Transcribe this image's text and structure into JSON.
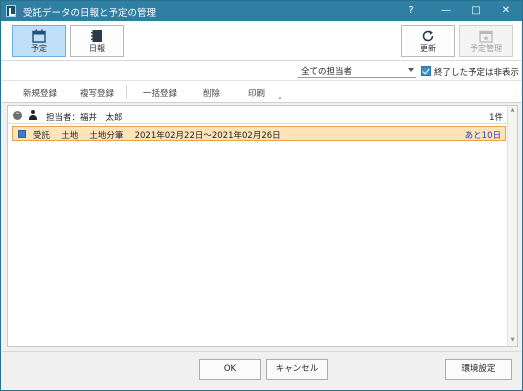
{
  "window": {
    "title": "受託データの日報と予定の管理",
    "help_label": "?",
    "minimize_label": "—",
    "maximize_label": "□",
    "close_label": "✕"
  },
  "ribbon": {
    "schedule_label": "予定",
    "daily_report_label": "日報",
    "refresh_label": "更新",
    "schedule_manage_label": "予定管理"
  },
  "filter": {
    "assignee_value": "全ての担当者",
    "hide_finished_label": "終了した予定は非表示",
    "hide_finished_checked": true
  },
  "actions": {
    "new_label": "新規登録",
    "copy_label": "複写登録",
    "bulk_label": "一括登録",
    "delete_label": "削除",
    "print_label": "印刷",
    "more_label": "⌄"
  },
  "list": {
    "group": {
      "collapse_glyph": "⌃",
      "label": "担当者：福井　太郎",
      "count": "1件"
    },
    "entry": {
      "text": "受託　 土地　 土地分筆　 2021年02月22日～2021年02月26日",
      "remaining": "あと10日",
      "mark_color": "#3b7dc8",
      "highlight_color": "#fde3b8"
    }
  },
  "footer": {
    "ok_label": "OK",
    "cancel_label": "キャンセル",
    "settings_label": "環境設定"
  }
}
